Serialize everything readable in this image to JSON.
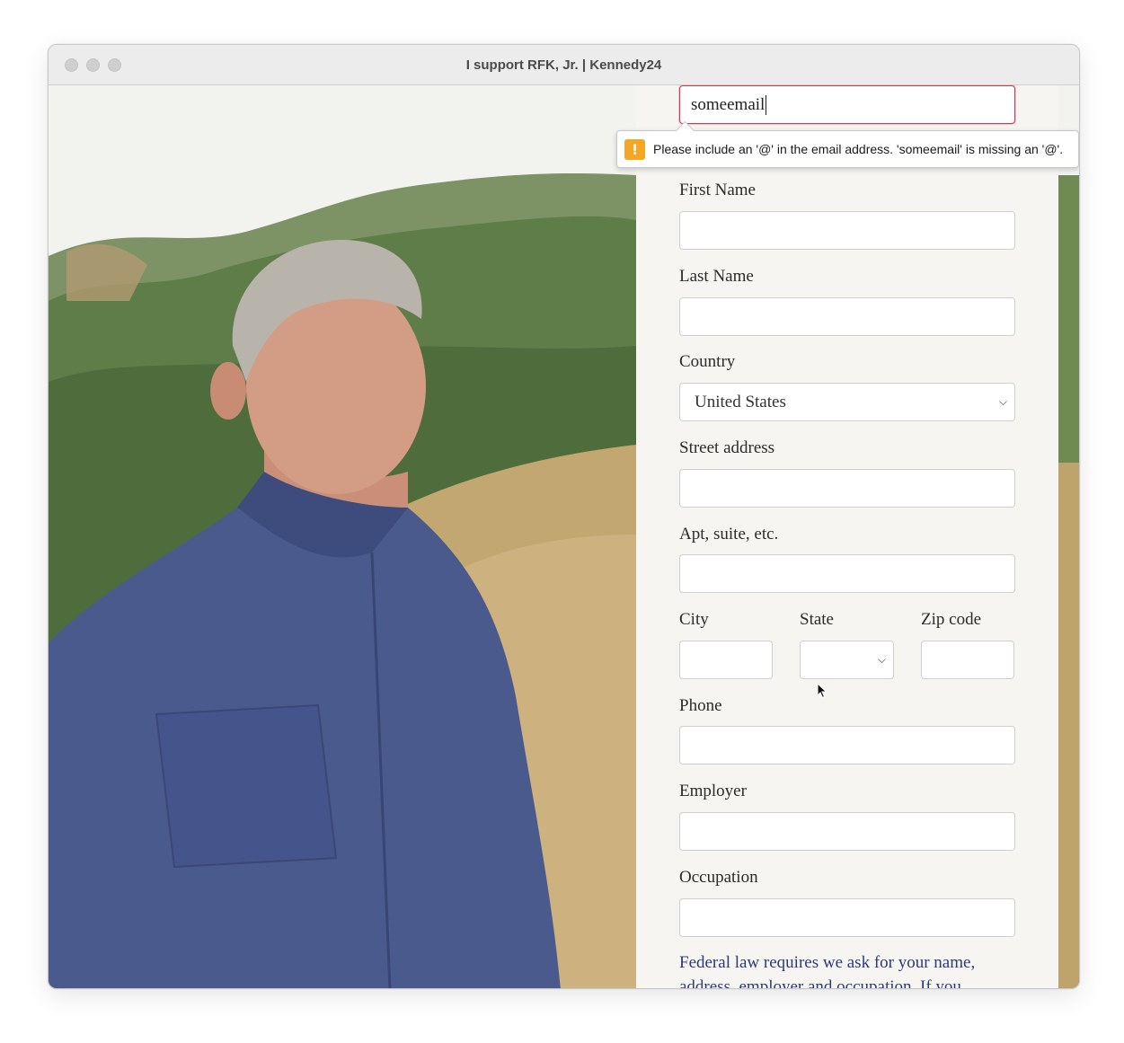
{
  "window": {
    "title": "I support RFK, Jr. | Kennedy24"
  },
  "email": {
    "value": "someemail"
  },
  "validation": {
    "message": "Please include an '@' in the email address. 'someemail' is missing an '@'.",
    "icon": "warning-icon"
  },
  "form": {
    "first_name": {
      "label": "First Name",
      "value": ""
    },
    "last_name": {
      "label": "Last Name",
      "value": ""
    },
    "country": {
      "label": "Country",
      "value": "United States"
    },
    "street": {
      "label": "Street address",
      "value": ""
    },
    "apt": {
      "label": "Apt, suite, etc.",
      "value": ""
    },
    "city": {
      "label": "City",
      "value": ""
    },
    "state": {
      "label": "State",
      "value": ""
    },
    "zip": {
      "label": "Zip code",
      "value": ""
    },
    "phone": {
      "label": "Phone",
      "value": ""
    },
    "employer": {
      "label": "Employer",
      "value": ""
    },
    "occupation": {
      "label": "Occupation",
      "value": ""
    },
    "legal_text": "Federal law requires we ask for your name, address, employer and occupation. If you"
  },
  "colors": {
    "error_border": "#d2394d",
    "legal_text": "#2e3a78",
    "warning": "#f5a623"
  }
}
